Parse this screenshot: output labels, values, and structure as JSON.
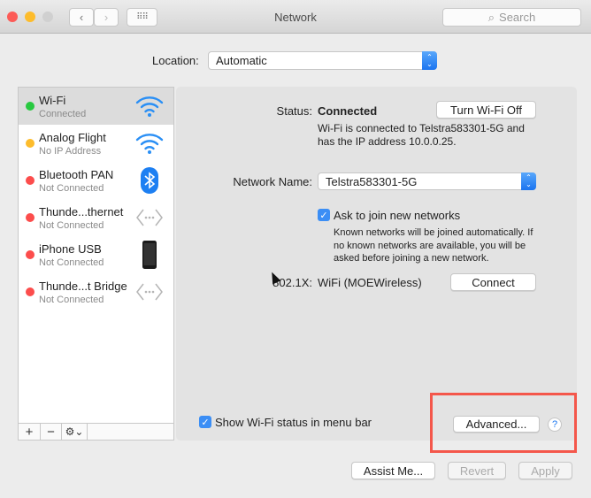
{
  "window": {
    "title": "Network",
    "search_placeholder": "Search"
  },
  "location": {
    "label": "Location:",
    "value": "Automatic"
  },
  "services": [
    {
      "name": "Wi-Fi",
      "status": "Connected",
      "dot": "#28c940",
      "icon": "wifi-icon",
      "selected": true
    },
    {
      "name": "Analog Flight",
      "status": "No IP Address",
      "dot": "#fdbc2c",
      "icon": "wifi-icon"
    },
    {
      "name": "Bluetooth PAN",
      "status": "Not Connected",
      "dot": "#fc4d4c",
      "icon": "bluetooth-icon"
    },
    {
      "name": "Thunde...thernet",
      "status": "Not Connected",
      "dot": "#fc4d4c",
      "icon": "ethernet-icon"
    },
    {
      "name": "iPhone USB",
      "status": "Not Connected",
      "dot": "#fc4d4c",
      "icon": "iphone-icon"
    },
    {
      "name": "Thunde...t Bridge",
      "status": "Not Connected",
      "dot": "#fc4d4c",
      "icon": "ethernet-icon"
    }
  ],
  "sidebar_bar": {
    "add": "+",
    "remove": "−",
    "gear": "⚙⌄"
  },
  "detail": {
    "status_label": "Status:",
    "status_value": "Connected",
    "turn_off_label": "Turn Wi-Fi Off",
    "status_desc_1": "Wi-Fi is connected to Telstra583301-5G and",
    "status_desc_2": "has the IP address 10.0.0.25.",
    "network_name_label": "Network Name:",
    "network_name_value": "Telstra583301-5G",
    "ask_join_label": "Ask to join new networks",
    "ask_join_checked": true,
    "ask_desc_1": "Known networks will be joined automatically. If",
    "ask_desc_2": "no known networks are available, you will be",
    "ask_desc_3": "asked before joining a new network.",
    "dot1x_label": "802.1X:",
    "dot1x_value": "WiFi (MOEWireless)",
    "connect_label": "Connect",
    "show_status_label": "Show Wi-Fi status in menu bar",
    "show_status_checked": true,
    "advanced_label": "Advanced...",
    "help_label": "?"
  },
  "footer": {
    "assist_label": "Assist Me...",
    "revert_label": "Revert",
    "apply_label": "Apply"
  },
  "colors": {
    "accent": "#3b8ef5",
    "highlight_box": "#f4574b"
  }
}
